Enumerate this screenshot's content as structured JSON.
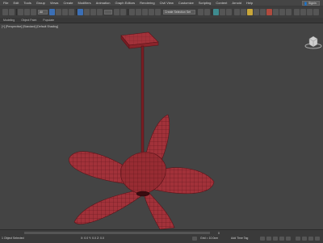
{
  "menu": {
    "items": [
      "File",
      "Edit",
      "Tools",
      "Group",
      "Views",
      "Create",
      "Modifiers",
      "Animation",
      "Graph Editors",
      "Rendering",
      "Civil View",
      "Customize",
      "Scripting",
      "Content",
      "Arnold",
      "Help"
    ],
    "search_label": "Signin"
  },
  "toolbar": {
    "filter_value": "All",
    "selection_set_value": "Create Selection Set"
  },
  "ribbon": {
    "tabs": [
      "Modeling",
      "Object Paint",
      "Populate"
    ]
  },
  "viewport": {
    "label": "[+] [Perspective] [Standard] [Default Shading]",
    "model_color": "#a2323a",
    "wire_color": "#5a1419",
    "background": "#444444"
  },
  "status": {
    "selection": "1 Object Selected",
    "coordinates": "X: 0.0   Y: 0.0   Z: 0.0",
    "grid": "Grid = 10.0cm",
    "add_time_tag": "Add Time Tag",
    "frame": "0"
  }
}
